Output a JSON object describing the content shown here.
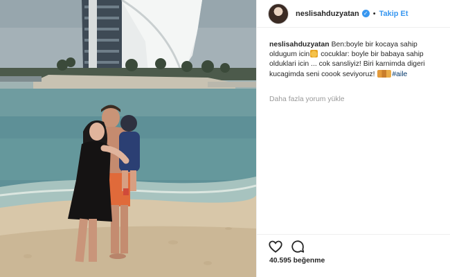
{
  "post": {
    "username": "neslisahduzyatan",
    "separator": "•",
    "follow_label": "Takip Et",
    "caption_user": "neslisahduzyatan",
    "caption_part1": "Ben:boyle bir kocaya sahip oldugum icin",
    "caption_part2": " cocuklar: boyle bir babaya sahip olduklari icin ... cok sansliyiz! Biri karnimda digeri kucagimda seni coook seviyoruz!",
    "hashtag": "#aile",
    "more_comments_label": "Daha fazla yorum yükle",
    "likes_label": "40.595 beğenme"
  },
  "icons": {
    "verified": "verified-badge-icon",
    "like": "heart-icon",
    "comment": "comment-bubble-icon",
    "emoji_pray": "folded-hands-emoji",
    "emoji_family": "family-emoji"
  },
  "colors": {
    "link_blue": "#3897f0",
    "hashtag": "#003569",
    "muted": "#999999",
    "text": "#262626"
  }
}
